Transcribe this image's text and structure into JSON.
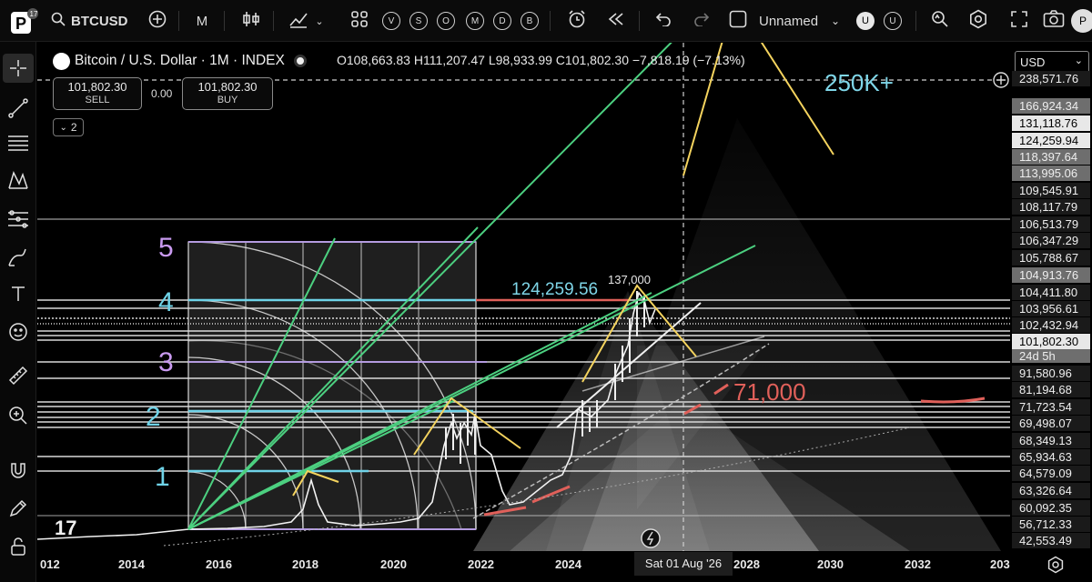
{
  "toolbar": {
    "symbol": "BTCUSD",
    "interval": "M",
    "replay_letters": [
      "V",
      "S",
      "O",
      "M",
      "D",
      "B"
    ],
    "layout_name": "Unnamed",
    "user_badges": [
      "U",
      "U"
    ],
    "profile_initial": "P"
  },
  "legend": {
    "title": "Bitcoin / U.S. Dollar · 1M · INDEX",
    "ohlc": "O108,663.83 H111,207.47 L98,933.99 C101,802.30 −7,818.19 (−7.13%)",
    "sell_price": "101,802.30",
    "sell_label": "SELL",
    "spread": "0.00",
    "buy_price": "101,802.30",
    "buy_label": "BUY",
    "collapse_count": "2"
  },
  "annotations": {
    "fib_levels": [
      "5",
      "4",
      "3",
      "2",
      "1"
    ],
    "price_124k": "124,259.56",
    "peak_137k": "137,000",
    "target_250k": "250K+",
    "support_71k": "71,000",
    "top_logo": "17"
  },
  "price_axis": {
    "currency": "USD",
    "labels": [
      "238,571.76",
      "166,924.34",
      "131,118.76",
      "124,259.94",
      "118,397.64",
      "113,995.06",
      "109,545.91",
      "108,117.79",
      "106,513.79",
      "106,347.29",
      "105,788.67",
      "104,913.76",
      "104,411.80",
      "103,956.61",
      "102,432.94",
      "101,802.30",
      "24d 5h",
      "91,580.96",
      "81,194.68",
      "71,723.54",
      "69,498.07",
      "68,349.13",
      "65,934.63",
      "64,579.09",
      "63,326.64",
      "60,092.35",
      "56,712.33",
      "42,553.49"
    ]
  },
  "time_axis": {
    "labels": [
      "012",
      "2014",
      "2016",
      "2018",
      "2020",
      "2022",
      "2024",
      "2028",
      "2030",
      "2032",
      "203"
    ],
    "cursor_date": "Sat 01 Aug '26"
  },
  "colors": {
    "background": "#000000",
    "fib_green": "#4cd080",
    "yellow": "#f4d35e",
    "cyan": "#6fd3e8",
    "purple": "#b49be0",
    "red": "#e0605a"
  }
}
